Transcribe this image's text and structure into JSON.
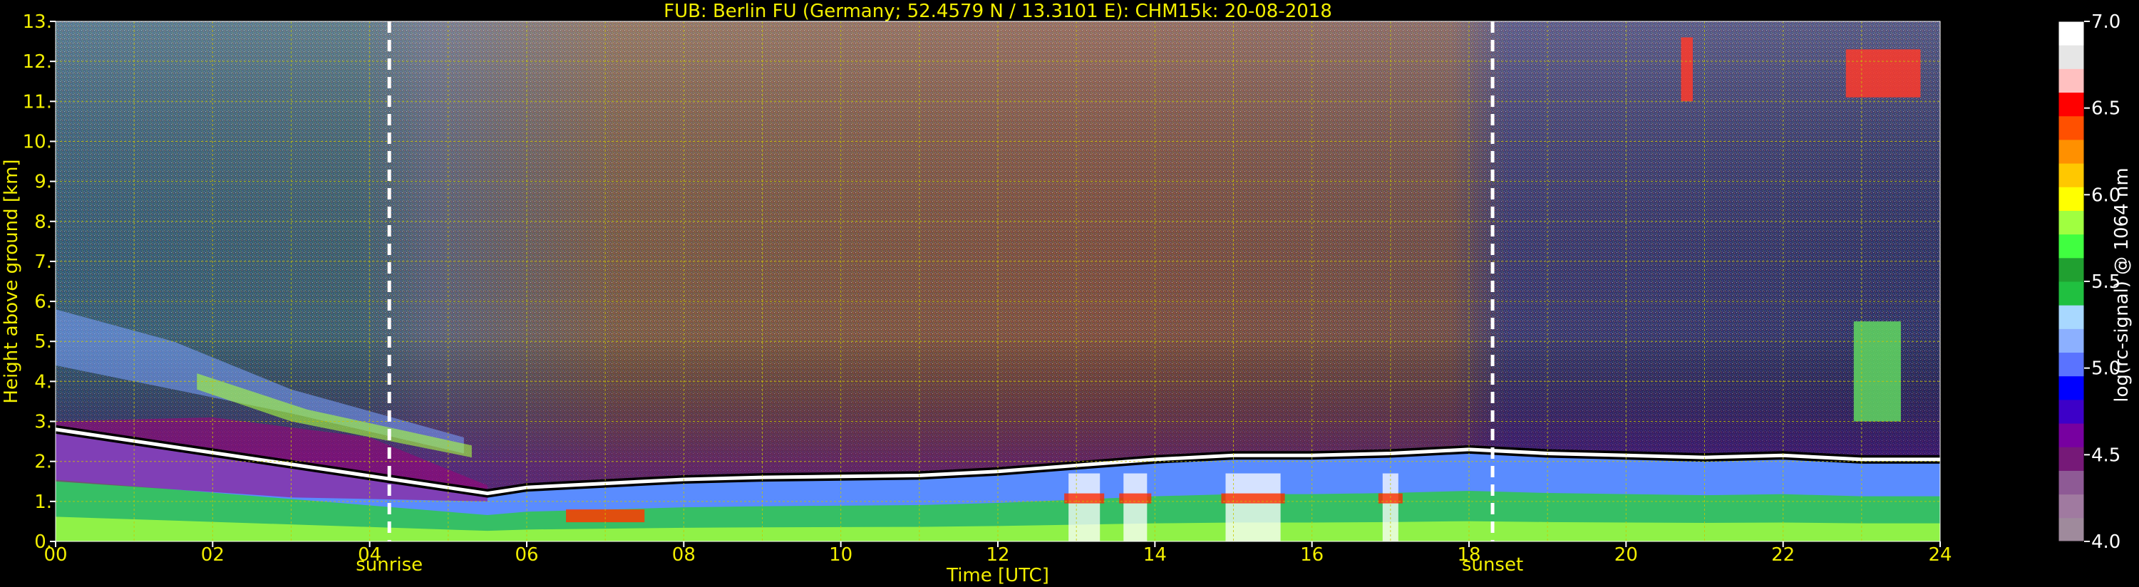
{
  "chart_data": {
    "type": "heatmap",
    "title": "FUB: Berlin FU (Germany; 52.4579 N / 13.3101 E):    CHM15k: 20-08-2018",
    "xlabel": "Time [UTC]",
    "ylabel": "Height above ground [km]",
    "xlim": [
      0,
      24
    ],
    "ylim": [
      0,
      13
    ],
    "x_ticks": [
      "00",
      "02",
      "04",
      "06",
      "08",
      "10",
      "12",
      "14",
      "16",
      "18",
      "20",
      "22",
      "24"
    ],
    "y_ticks": [
      "0.",
      "1.",
      "2.",
      "3.",
      "4.",
      "5.",
      "6.",
      "7.",
      "8.",
      "9.",
      "10.",
      "11.",
      "12.",
      "13."
    ],
    "grid": true,
    "events": [
      {
        "label": "sunrise",
        "time_h": 4.25
      },
      {
        "label": "sunset",
        "time_h": 18.3
      }
    ],
    "colorbar": {
      "label": "log(rc-signal) @ 1064 nm",
      "range": [
        4.0,
        7.0
      ],
      "ticks": [
        "4.0",
        "4.5",
        "5.0",
        "5.5",
        "6.0",
        "6.5",
        "7.0"
      ],
      "colors": [
        "#9f8a9c",
        "#a07aa0",
        "#8e5a95",
        "#761978",
        "#7700a0",
        "#3d00c8",
        "#0000ff",
        "#5a73ff",
        "#8cb0ff",
        "#a8d8ff",
        "#20c040",
        "#20a030",
        "#40ff40",
        "#a0ff40",
        "#ffff00",
        "#ffc800",
        "#ff9000",
        "#ff5000",
        "#ff0000",
        "#ffc0c0",
        "#e6e6e6",
        "#ffffff"
      ]
    },
    "boundary_layer_top_km": [
      {
        "t": 0,
        "h": 2.8
      },
      {
        "t": 5.5,
        "h": 1.2
      },
      {
        "t": 6,
        "h": 1.35
      },
      {
        "t": 7,
        "h": 1.45
      },
      {
        "t": 8,
        "h": 1.55
      },
      {
        "t": 9,
        "h": 1.6
      },
      {
        "t": 11,
        "h": 1.65
      },
      {
        "t": 12,
        "h": 1.75
      },
      {
        "t": 13,
        "h": 1.9
      },
      {
        "t": 14,
        "h": 2.05
      },
      {
        "t": 15,
        "h": 2.15
      },
      {
        "t": 16,
        "h": 2.15
      },
      {
        "t": 17,
        "h": 2.2
      },
      {
        "t": 18,
        "h": 2.3
      },
      {
        "t": 19,
        "h": 2.2
      },
      {
        "t": 20,
        "h": 2.15
      },
      {
        "t": 21,
        "h": 2.1
      },
      {
        "t": 22,
        "h": 2.15
      },
      {
        "t": 23,
        "h": 2.05
      },
      {
        "t": 24,
        "h": 2.05
      }
    ],
    "cloud_patches": [
      {
        "t0": 22.8,
        "t1": 23.75,
        "h0": 11.1,
        "h1": 12.3,
        "value": 6.2
      },
      {
        "t0": 20.7,
        "t1": 20.85,
        "h0": 11.0,
        "h1": 12.6,
        "value": 6.0
      },
      {
        "t0": 22.9,
        "t1": 23.5,
        "h0": 3.0,
        "h1": 5.5,
        "value": 5.3
      }
    ]
  }
}
